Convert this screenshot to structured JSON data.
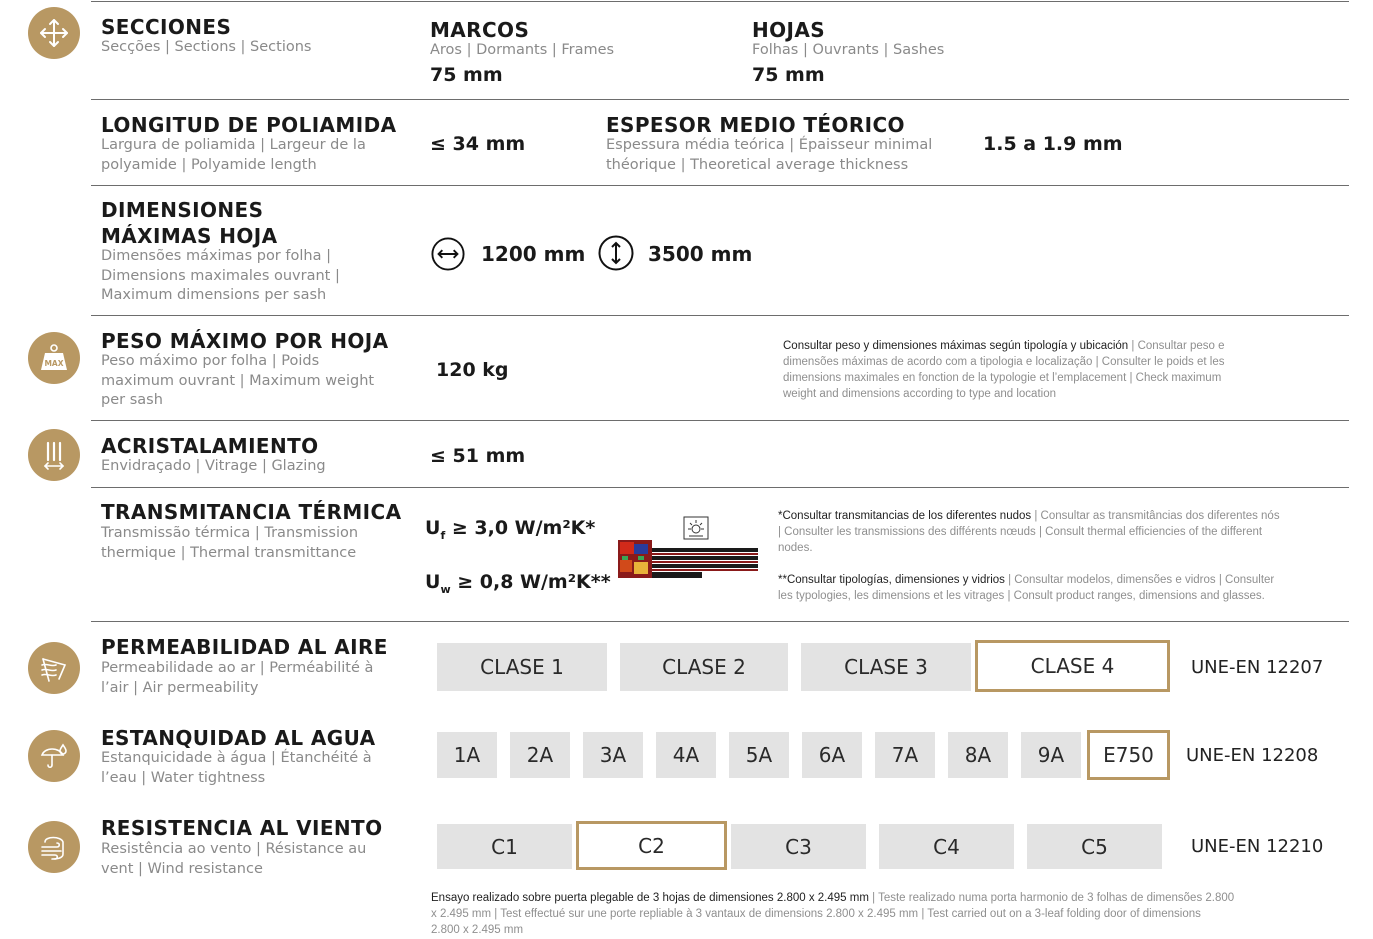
{
  "colors": {
    "accent": "#b89863",
    "box_bg": "#e3e3e3",
    "rule": "#6d6d6d"
  },
  "secciones": {
    "icon": "move-arrows-icon",
    "title": "SECCIONES",
    "subtitle": "Secções | Sections | Sections",
    "marcos": {
      "title": "MARCOS",
      "subtitle": "Aros | Dormants | Frames",
      "value": "75 mm"
    },
    "hojas": {
      "title": "HOJAS",
      "subtitle": "Folhas | Ouvrants | Sashes",
      "value": "75 mm"
    }
  },
  "poliamida": {
    "title": "LONGITUD DE POLIAMIDA",
    "subtitle": [
      "Largura de poliamida | Largeur de la",
      "polyamide | Polyamide length"
    ],
    "value": "≤ 34 mm",
    "espesor": {
      "title": "ESPESOR MEDIO TÉORICO",
      "subtitle": [
        "Espessura média teórica | Épaisseur minimal",
        "théorique | Theoretical average thickness"
      ],
      "value": "1.5 a 1.9 mm"
    }
  },
  "dimensiones": {
    "title": [
      "DIMENSIONES",
      "MÁXIMAS HOJA"
    ],
    "subtitle": [
      "Dimensões máximas por folha |",
      "Dimensions maximales ouvrant |",
      "Maximum dimensions per sash"
    ],
    "width_icon": "horizontal-arrow-icon",
    "width_value": "1200 mm",
    "height_icon": "vertical-arrow-icon",
    "height_value": "3500 mm"
  },
  "peso": {
    "icon": "weight-max-icon",
    "icon_text": "MAX",
    "title": "PESO MÁXIMO POR HOJA",
    "subtitle": [
      "Peso máximo por folha | Poids",
      "maximum ouvrant | Maximum weight",
      "per sash"
    ],
    "value": "120 kg",
    "note_strong": "Consultar peso y dimensiones máximas según tipología y ubicación",
    "note_rest": [
      " | Consultar peso e",
      "dimensões máximas de acordo com a tipologia e localização | Consulter le poids et les",
      "dimensions maximales en fonction de la typologie et l’emplacement | Check maximum",
      "weight and dimensions according to type and location"
    ]
  },
  "acristalamiento": {
    "icon": "glazing-icon",
    "title": "ACRISTALAMIENTO",
    "subtitle": "Envidraçado | Vitrage | Glazing",
    "value": "≤ 51 mm"
  },
  "transmitancia": {
    "title": "TRANSMITANCIA TÉRMICA",
    "subtitle": [
      "Transmissão térmica | Transmission",
      "thermique | Thermal transmittance"
    ],
    "uf_label": "U",
    "uf_sub": "f",
    "uf_value": " ≥ 3,0 W/m²K*",
    "uw_label": "U",
    "uw_sub": "w",
    "uw_value": " ≥ 0,8 W/m²K**",
    "sun_icon": "sun-icon",
    "note1_strong": "*Consultar transmitancias de los diferentes nudos",
    "note1_rest": [
      " | Consultar as transmitâncias dos diferentes nós",
      "| Consulter les transmissions des différents nœuds | Consult thermal efficiencies of the different",
      "nodes."
    ],
    "note2_strong": "**Consultar tipologías, dimensiones y vidrios",
    "note2_rest": [
      " | Consultar modelos, dimensões e vidros | Consulter",
      "les typologies, les dimensions et les vitrages | Consult product ranges, dimensions and glasses."
    ]
  },
  "aire": {
    "icon": "air-permeability-icon",
    "title": "PERMEABILIDAD AL AIRE",
    "subtitle": [
      "Permeabilidade ao ar | Perméabilité à",
      "l’air | Air permeability"
    ],
    "classes": [
      "CLASE 1",
      "CLASE 2",
      "CLASE 3",
      "CLASE 4"
    ],
    "selected": "CLASE 4",
    "standard": "UNE-EN 12207"
  },
  "agua": {
    "icon": "water-tightness-icon",
    "title": "ESTANQUIDAD AL AGUA",
    "subtitle": [
      "Estanquicidade à água | Étanchéité à",
      "l’eau | Water tightness"
    ],
    "classes": [
      "1A",
      "2A",
      "3A",
      "4A",
      "5A",
      "6A",
      "7A",
      "8A",
      "9A",
      "E750"
    ],
    "selected": "E750",
    "standard": "UNE-EN 12208"
  },
  "viento": {
    "icon": "wind-resistance-icon",
    "title": "RESISTENCIA AL VIENTO",
    "subtitle": [
      "Resistência ao vento | Résistance au",
      "vent | Wind resistance"
    ],
    "classes": [
      "C1",
      "C2",
      "C3",
      "C4",
      "C5"
    ],
    "selected": "C2",
    "standard": "UNE-EN 12210"
  },
  "footnote": {
    "strong": "Ensayo realizado sobre puerta plegable de 3 hojas de dimensiones 2.800 x 2.495 mm",
    "rest": [
      " | Teste realizado numa porta harmonio de 3 folhas de dimensões 2.800",
      "x 2.495 mm | Test effectué sur une porte repliable à 3 vantaux de dimensions 2.800 x 2.495 mm | Test carried out on a 3-leaf folding door of dimensions",
      "2.800 x 2.495 mm"
    ]
  }
}
